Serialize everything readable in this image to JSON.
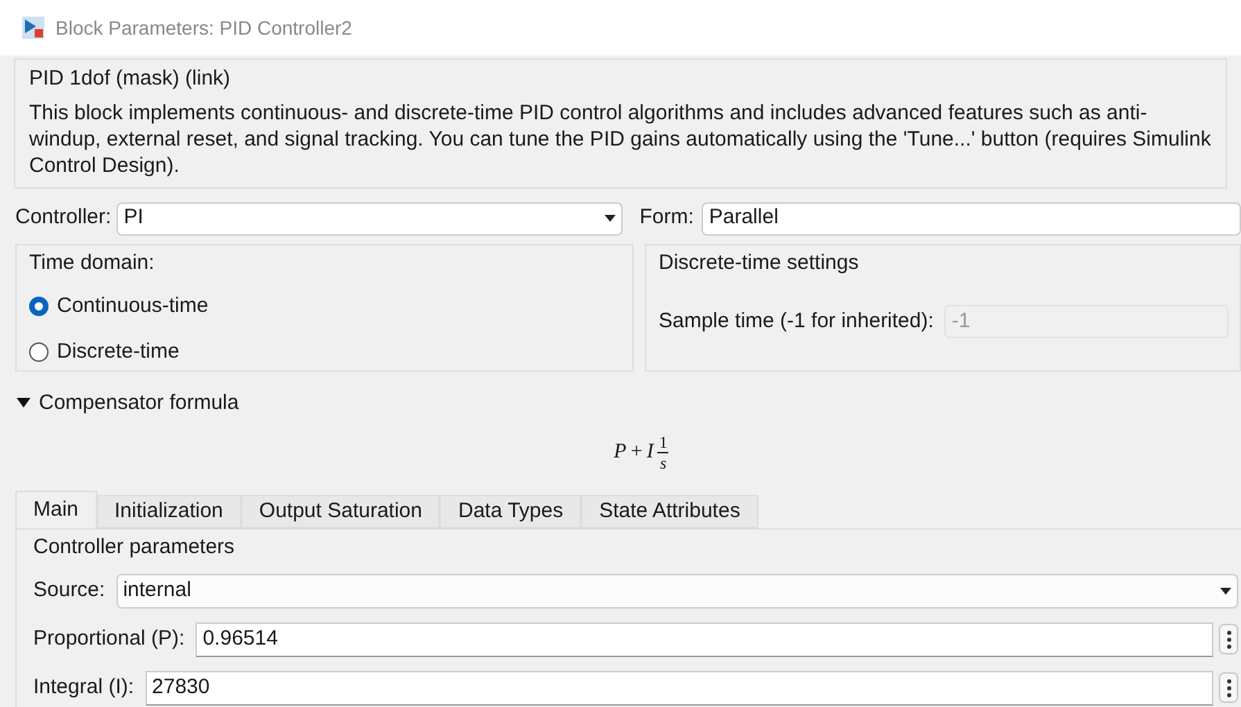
{
  "window": {
    "title": "Block Parameters: PID Controller2"
  },
  "mask": {
    "title": "PID 1dof (mask) (link)",
    "description": "This block implements continuous- and discrete-time PID control algorithms and includes advanced features such as anti-windup, external reset, and signal tracking. You can tune the PID gains automatically using the 'Tune...' button (requires Simulink Control Design)."
  },
  "controller": {
    "label": "Controller:",
    "value": "PI"
  },
  "form": {
    "label": "Form:",
    "value": "Parallel"
  },
  "time_domain": {
    "title": "Time domain:",
    "options": [
      {
        "label": "Continuous-time",
        "selected": true
      },
      {
        "label": "Discrete-time",
        "selected": false
      }
    ]
  },
  "discrete_settings": {
    "title": "Discrete-time settings",
    "sample_time": {
      "label": "Sample time (-1 for inherited):",
      "value": "-1",
      "disabled": true
    }
  },
  "compensator": {
    "label": "Compensator formula",
    "expanded": true,
    "formula": {
      "p": "P",
      "plus": "+",
      "i": "I",
      "numerator": "1",
      "denominator": "s"
    }
  },
  "tabs": [
    {
      "label": "Main",
      "selected": true
    },
    {
      "label": "Initialization",
      "selected": false
    },
    {
      "label": "Output Saturation",
      "selected": false
    },
    {
      "label": "Data Types",
      "selected": false
    },
    {
      "label": "State Attributes",
      "selected": false
    }
  ],
  "controller_parameters": {
    "title": "Controller parameters",
    "source": {
      "label": "Source:",
      "value": "internal"
    },
    "fields": [
      {
        "label": "Proportional (P):",
        "value": "0.96514"
      },
      {
        "label": "Integral (I):",
        "value": "27830"
      }
    ]
  }
}
